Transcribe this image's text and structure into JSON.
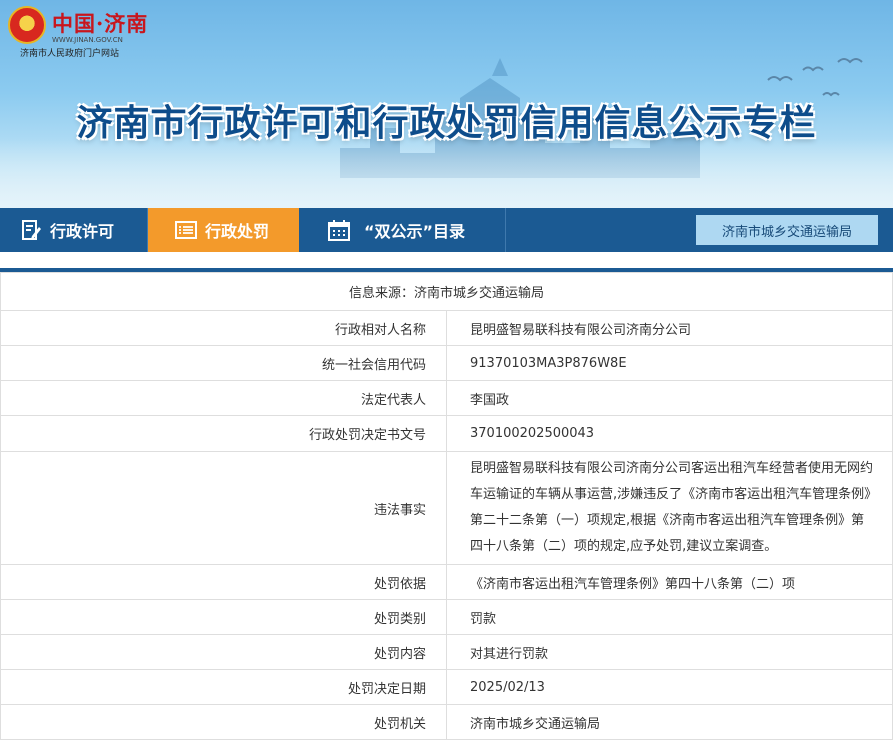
{
  "header": {
    "site_name": "中国·济南",
    "domain": "WWW.JINAN.GOV.CN",
    "portal": "济南市人民政府门户网站",
    "title": "济南市行政许可和行政处罚信用信息公示专栏"
  },
  "nav": {
    "tabs": [
      {
        "label": "行政许可",
        "icon": "document-edit-icon",
        "active": false
      },
      {
        "label": "行政处罚",
        "icon": "list-icon",
        "active": true
      },
      {
        "label": "“双公示”目录",
        "icon": "calendar-icon",
        "active": false
      }
    ],
    "department": "济南市城乡交通运输局"
  },
  "record": {
    "source_label": "信息来源：济南市城乡交通运输局",
    "rows": [
      {
        "label": "行政相对人名称",
        "value": "昆明盛智易联科技有限公司济南分公司"
      },
      {
        "label": "统一社会信用代码",
        "value": "91370103MA3P876W8E"
      },
      {
        "label": "法定代表人",
        "value": "李国政"
      },
      {
        "label": "行政处罚决定书文号",
        "value": "370100202500043"
      },
      {
        "label": "违法事实",
        "value": "昆明盛智易联科技有限公司济南分公司客运出租汽车经营者使用无网约车运输证的车辆从事运营,涉嫌违反了《济南市客运出租汽车管理条例》第二十二条第（一）项规定,根据《济南市客运出租汽车管理条例》第四十八条第（二）项的规定,应予处罚,建议立案调查。"
      },
      {
        "label": "处罚依据",
        "value": "《济南市客运出租汽车管理条例》第四十八条第（二）项"
      },
      {
        "label": "处罚类别",
        "value": "罚款"
      },
      {
        "label": "处罚内容",
        "value": "对其进行罚款"
      },
      {
        "label": "处罚决定日期",
        "value": "2025/02/13"
      },
      {
        "label": "处罚机关",
        "value": "济南市城乡交通运输局"
      }
    ]
  },
  "colors": {
    "nav_bg": "#1b5a93",
    "active_tab": "#f39a2b",
    "label_text": "#1a5d9a",
    "title_text": "#0e4d8b"
  }
}
